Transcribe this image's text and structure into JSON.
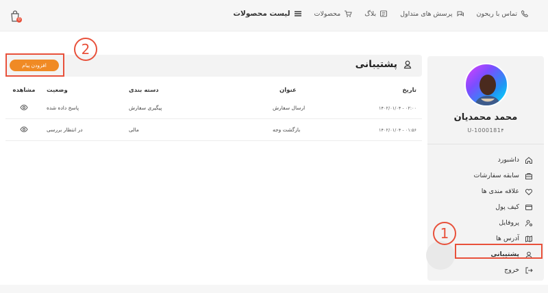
{
  "header": {
    "nav": [
      {
        "label": "لیست محصولات",
        "icon": "hamburger-icon"
      },
      {
        "label": "محصولات",
        "icon": "cart-icon"
      },
      {
        "label": "بلاگ",
        "icon": "blog-icon"
      },
      {
        "label": "پرسش های متداول",
        "icon": "chat-icon"
      },
      {
        "label": "تماس با ریحون",
        "icon": "phone-icon"
      }
    ],
    "cart_count": "0"
  },
  "profile": {
    "name": "محمد محمدیان",
    "user_id": "U-1000181۴"
  },
  "menu": [
    {
      "label": "داشبورد",
      "icon": "home-icon"
    },
    {
      "label": "سابقه سفارشات",
      "icon": "orders-icon"
    },
    {
      "label": "علاقه مندی ها",
      "icon": "heart-icon"
    },
    {
      "label": "کیف پول",
      "icon": "wallet-icon"
    },
    {
      "label": "پروفایل",
      "icon": "user-settings-icon"
    },
    {
      "label": "آدرس ها",
      "icon": "map-icon"
    },
    {
      "label": "پشتیبانی",
      "icon": "support-icon",
      "active": true
    },
    {
      "label": "خروج",
      "icon": "logout-icon"
    }
  ],
  "support": {
    "title": "پشتیبانی",
    "add_button": "افزودن پیام",
    "columns": [
      "تاریخ",
      "عنوان",
      "دسته بندی",
      "وضعیت",
      "مشاهده"
    ],
    "rows": [
      {
        "date": "۱۴۰۲/۰۱/۰۴ - ۰۲:۰۰",
        "title": "ارسال سفارش",
        "category": "پیگیری سفارش",
        "status": "پاسخ داده شده"
      },
      {
        "date": "۱۴۰۲/۰۱/۰۴ - ۰۱:۵۶",
        "title": "بازگشت وجه",
        "category": "مالی",
        "status": "در انتظار بررسی"
      }
    ]
  },
  "annotations": {
    "marker1": "1",
    "marker2": "2"
  },
  "colors": {
    "accent": "#f08a24",
    "annotation": "#e8503a",
    "panel": "#f3f3f3"
  }
}
